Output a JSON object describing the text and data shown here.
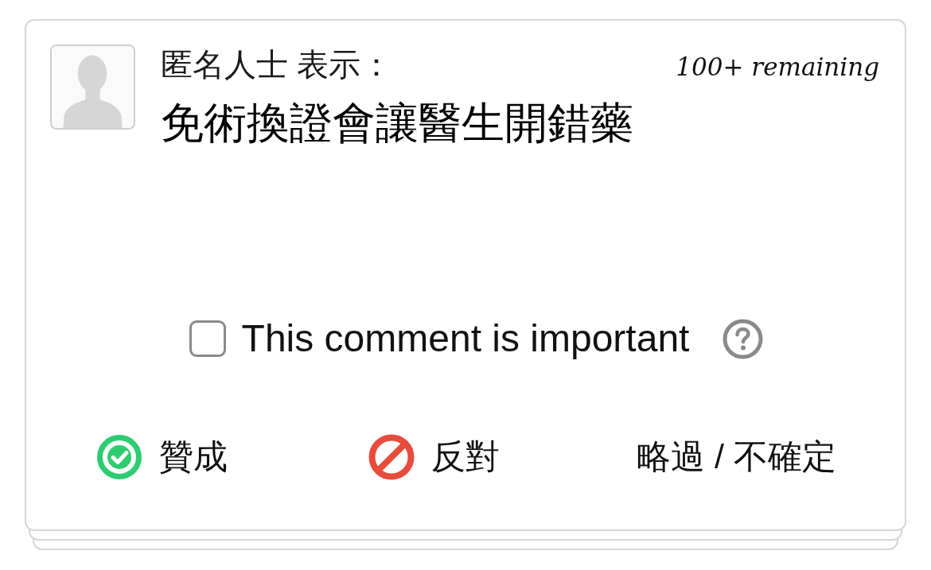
{
  "card": {
    "author": "匿名人士 表示：",
    "remaining": "100+ remaining",
    "statement": "免術換證會讓醫生開錯藥",
    "important": {
      "label": "This comment is important",
      "checked": false
    },
    "votes": [
      {
        "kind": "agree",
        "label": "贊成"
      },
      {
        "kind": "disagree",
        "label": "反對"
      },
      {
        "kind": "pass",
        "label": "略過 / 不確定"
      }
    ]
  }
}
